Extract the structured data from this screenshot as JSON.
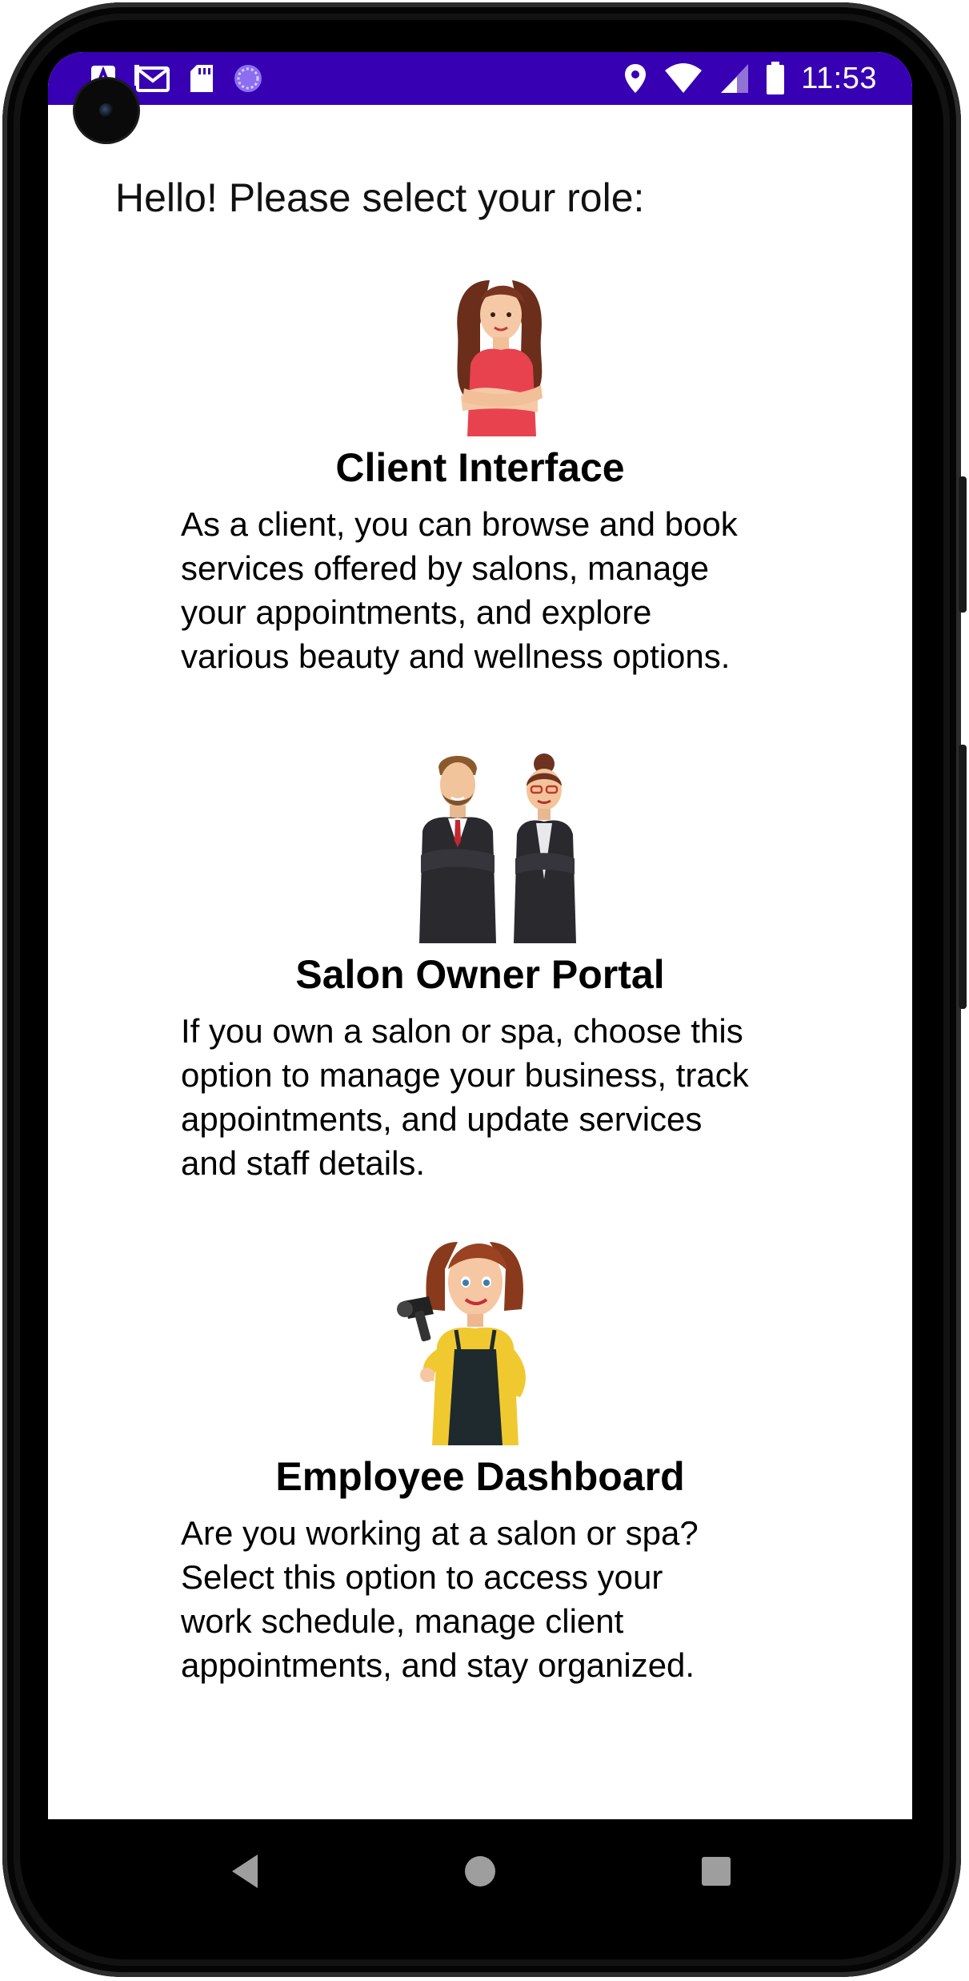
{
  "status_bar": {
    "time": "11:53",
    "background_color": "#3700B3",
    "left_icons": [
      "notification-a-icon",
      "gmail-icon",
      "sd-card-icon",
      "sync-circle-icon"
    ],
    "right_icons": [
      "location-icon",
      "wifi-icon",
      "cell-signal-icon",
      "battery-icon"
    ]
  },
  "main": {
    "prompt": "Hello! Please select your role:",
    "roles": [
      {
        "title": "Client Interface",
        "description_lines": [
          "As a client, you can browse and book",
          "services offered by salons, manage",
          "your appointments, and explore",
          "various beauty and wellness options."
        ],
        "illustration": "woman-arms-crossed-illustration"
      },
      {
        "title": "Salon Owner Portal",
        "description_lines": [
          "If you own a salon or spa, choose this",
          "option to manage your business, track",
          "appointments, and update services",
          "and staff details."
        ],
        "illustration": "business-couple-illustration"
      },
      {
        "title": "Employee Dashboard",
        "description_lines": [
          "Are you working at a salon or spa?",
          "Select this option to access your",
          "work schedule, manage client",
          "appointments, and stay organized."
        ],
        "illustration": "hairdresser-with-dryer-illustration"
      }
    ]
  },
  "nav_bar": {
    "buttons": [
      "back-icon",
      "home-icon",
      "recents-icon"
    ]
  }
}
